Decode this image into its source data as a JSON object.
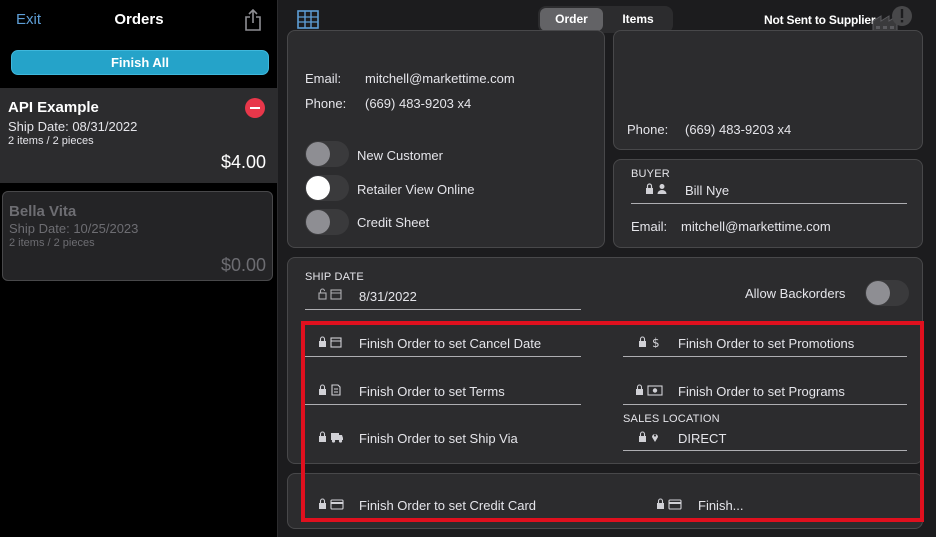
{
  "sidebar": {
    "exit_label": "Exit",
    "title": "Orders",
    "finish_all_label": "Finish All",
    "orders": [
      {
        "name": "API Example",
        "ship_date": "Ship Date: 08/31/2022",
        "items": "2 items / 2 pieces",
        "total": "$4.00"
      },
      {
        "name": "Bella Vita",
        "ship_date": "Ship Date: 10/25/2023",
        "items": "2 items / 2 pieces",
        "total": "$0.00"
      }
    ]
  },
  "header": {
    "tabs": [
      {
        "label": "Order",
        "selected": true
      },
      {
        "label": "Items",
        "selected": false
      }
    ],
    "status": "Not Sent to Supplier"
  },
  "customer": {
    "email_label": "Email:",
    "email": "mitchell@markettime.com",
    "phone_label": "Phone:",
    "phone": "(669) 483-9203 x4",
    "toggles": [
      {
        "label": "New Customer",
        "on": false
      },
      {
        "label": "Retailer View Online",
        "on": true
      },
      {
        "label": "Credit Sheet",
        "on": false
      }
    ]
  },
  "shipping_contact": {
    "phone_label": "Phone:",
    "phone": "(669) 483-9203 x4"
  },
  "buyer": {
    "section_label": "BUYER",
    "name": "Bill Nye",
    "email_label": "Email:",
    "email": "mitchell@markettime.com"
  },
  "order_details": {
    "ship_date_label": "SHIP DATE",
    "ship_date": "8/31/2022",
    "allow_backorders_label": "Allow Backorders",
    "allow_backorders": false,
    "cancel_date": "Finish Order to set Cancel Date",
    "promotions": "Finish Order to set Promotions",
    "terms": "Finish Order to set Terms",
    "programs": "Finish Order to set Programs",
    "ship_via": "Finish Order to set Ship Via",
    "sales_location_label": "SALES LOCATION",
    "sales_location": "DIRECT"
  },
  "payment": {
    "credit_card": "Finish Order to set Credit Card",
    "second_field": "Finish..."
  },
  "colors": {
    "accent": "#25a3c9",
    "highlight": "#e0101e",
    "delete": "#e8374a"
  }
}
